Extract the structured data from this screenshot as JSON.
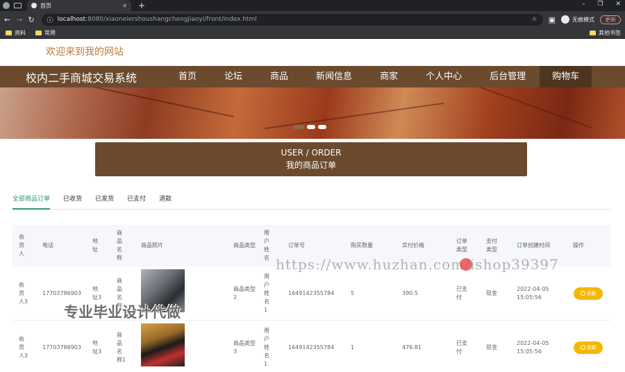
{
  "browser": {
    "tab_title": "首页",
    "url_host": "localhost",
    "url_rest": ":8080/xiaoneiershoushangchengjiaoyi/front/index.html",
    "profile_label": "无痕模式",
    "update_label": "更新",
    "bookmarks": [
      "资料",
      "常用"
    ],
    "bookmarks_right": "其他书签"
  },
  "site": {
    "welcome": "欢迎来到我的网站",
    "title": "校内二手商城交易系统",
    "menu": [
      "首页",
      "论坛",
      "商品",
      "新闻信息",
      "商家",
      "个人中心",
      "后台管理",
      "购物车"
    ]
  },
  "section": {
    "title_en": "USER / ORDER",
    "title_cn": "我的商品订单"
  },
  "tabs": [
    "全部商品订单",
    "已收货",
    "已发货",
    "已支付",
    "退款"
  ],
  "table": {
    "headers": [
      "收货人",
      "电话",
      "地址",
      "商品名称",
      "商品照片",
      "商品类型",
      "用户姓名",
      "订单号",
      "购买数量",
      "实付价格",
      "订单类型",
      "支付类型",
      "订单创建时间",
      "操作"
    ],
    "rows": [
      {
        "receiver": "收货人3",
        "phone": "17703786903",
        "address": "地址3",
        "product": "商品名称",
        "type": "商品类型2",
        "user": "用户姓名1",
        "order_no": "1649142355784",
        "qty": "5",
        "price": "390.5",
        "order_type": "已支付",
        "pay_type": "现金",
        "created_date": "2022-04-05",
        "created_time": "15:05:56",
        "action": "退款"
      },
      {
        "receiver": "收货人3",
        "phone": "17703786903",
        "address": "地址3",
        "product": "商品名称1",
        "type": "商品类型3",
        "user": "用户姓名1",
        "order_no": "1649142355784",
        "qty": "1",
        "price": "476.81",
        "order_type": "已支付",
        "pay_type": "现金",
        "created_date": "2022-04-05",
        "created_time": "15:05:56",
        "action": "退款"
      }
    ]
  },
  "watermarks": {
    "url": "https://www.huzhan.com/ishop39397",
    "cn": "专业毕业设计代做"
  },
  "colors": {
    "brand_brown": "#6b4a2e",
    "tab_active": "#2a9d6f",
    "refund_button": "#f5b800"
  }
}
